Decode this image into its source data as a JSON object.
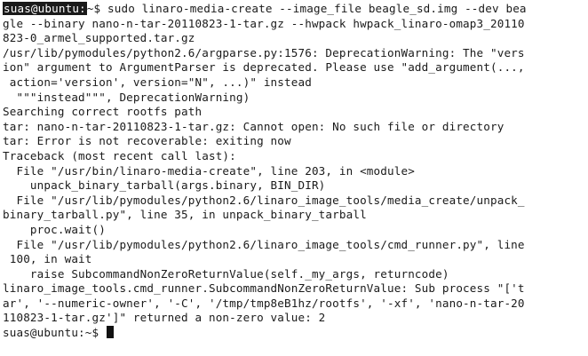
{
  "terminal": {
    "prompt_highlighted": "suas@ubuntu:",
    "prompt_path": "~$",
    "command": " sudo linaro-media-create --image_file beagle_sd.img --dev bea",
    "lines": [
      "gle --binary nano-n-tar-20110823-1-tar.gz --hwpack hwpack_linaro-omap3_20110",
      "823-0_armel_supported.tar.gz",
      "/usr/lib/pymodules/python2.6/argparse.py:1576: DeprecationWarning: The \"vers",
      "ion\" argument to ArgumentParser is deprecated. Please use \"add_argument(...,",
      " action='version', version=\"N\", ...)\" instead",
      "  \"\"\"instead\"\"\", DeprecationWarning)",
      "Searching correct rootfs path",
      "tar: nano-n-tar-20110823-1-tar.gz: Cannot open: No such file or directory",
      "tar: Error is not recoverable: exiting now",
      "Traceback (most recent call last):",
      "  File \"/usr/bin/linaro-media-create\", line 203, in <module>",
      "    unpack_binary_tarball(args.binary, BIN_DIR)",
      "  File \"/usr/lib/pymodules/python2.6/linaro_image_tools/media_create/unpack_",
      "binary_tarball.py\", line 35, in unpack_binary_tarball",
      "    proc.wait()",
      "  File \"/usr/lib/pymodules/python2.6/linaro_image_tools/cmd_runner.py\", line",
      " 100, in wait",
      "    raise SubcommandNonZeroReturnValue(self._my_args, returncode)",
      "linaro_image_tools.cmd_runner.SubcommandNonZeroReturnValue: Sub process \"['t",
      "ar', '--numeric-owner', '-C', '/tmp/tmp8eB1hz/rootfs', '-xf', 'nano-n-tar-20",
      "110823-1-tar.gz']\" returned a non-zero value: 2"
    ],
    "final_prompt": "suas@ubuntu:~$ "
  }
}
